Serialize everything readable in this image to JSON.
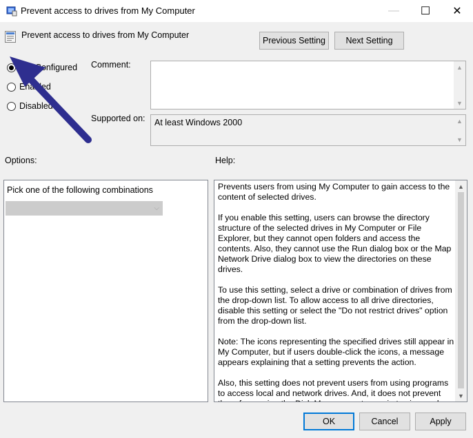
{
  "window": {
    "title": "Prevent access to drives from My Computer",
    "minimize_glyph": "—",
    "maximize_glyph": "☐",
    "close_glyph": "✕"
  },
  "policy": {
    "name": "Prevent access to drives from My Computer"
  },
  "nav": {
    "previous_label": "Previous Setting",
    "next_label": "Next Setting"
  },
  "state": {
    "options": [
      {
        "label": "Not Configured",
        "checked": true
      },
      {
        "label": "Enabled",
        "checked": false
      },
      {
        "label": "Disabled",
        "checked": false
      }
    ]
  },
  "comment": {
    "label": "Comment:",
    "value": ""
  },
  "supported": {
    "label": "Supported on:",
    "value": "At least Windows 2000"
  },
  "options_section": {
    "label": "Options:",
    "pick_label": "Pick one of the following combinations",
    "selected_value": ""
  },
  "help_section": {
    "label": "Help:",
    "paragraphs": [
      "Prevents users from using My Computer to gain access to the content of selected drives.",
      "If you enable this setting, users can browse the directory structure of the selected drives in My Computer or File Explorer, but they cannot open folders and access the contents. Also, they cannot use the Run dialog box or the Map Network Drive dialog box to view the directories on these drives.",
      "To use this setting, select a drive or combination of drives from the drop-down list. To allow access to all drive directories, disable this setting or select the \"Do not restrict drives\" option from the drop-down list.",
      "Note: The icons representing the specified drives still appear in My Computer, but if users double-click the icons, a message appears explaining that a setting prevents the action.",
      " Also, this setting does not prevent users from using programs to access local and network drives. And, it does not prevent them from using the Disk Management snap-in to view and change drive characteristics."
    ]
  },
  "footer": {
    "ok_label": "OK",
    "cancel_label": "Cancel",
    "apply_label": "Apply"
  },
  "colors": {
    "annotation_arrow": "#2e2e8f",
    "focus_border": "#0078d7"
  }
}
